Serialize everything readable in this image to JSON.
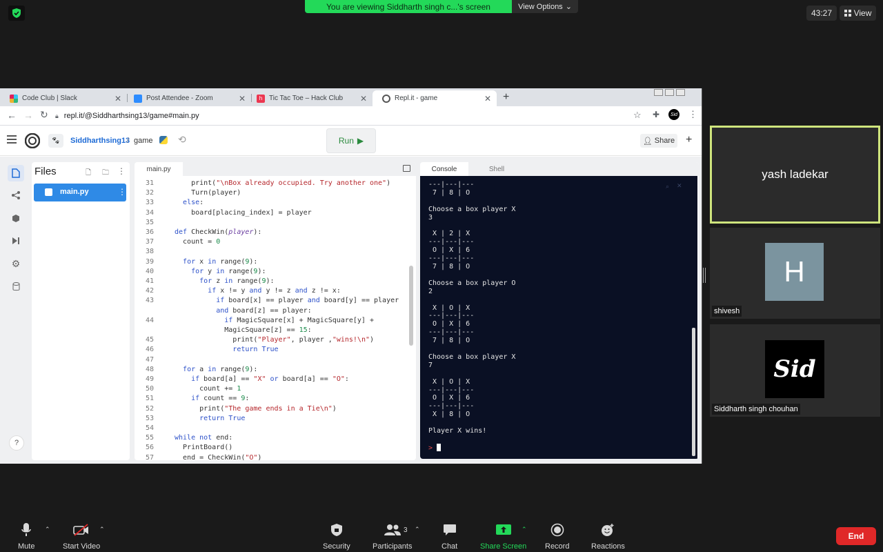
{
  "zoom": {
    "banner_text": "You are viewing Siddharth singh c...'s screen",
    "view_options": "View Options",
    "timer": "43:27",
    "view_label": "View",
    "participants": [
      {
        "name": "yash ladekar",
        "initial": ""
      },
      {
        "name": "shivesh",
        "initial": "H"
      },
      {
        "name": "Siddharth singh chouhan",
        "initial": "Sid"
      }
    ],
    "toolbar": {
      "mute": "Mute",
      "start_video": "Start Video",
      "security": "Security",
      "participants": "Participants",
      "participants_count": "3",
      "chat": "Chat",
      "share_screen": "Share Screen",
      "record": "Record",
      "reactions": "Reactions",
      "end": "End"
    },
    "accent_green": "#23d959",
    "end_red": "#e02828"
  },
  "browser": {
    "tabs": [
      {
        "title": "Code Club | Slack"
      },
      {
        "title": "Post Attendee - Zoom"
      },
      {
        "title": "Tic Tac Toe – Hack Club"
      },
      {
        "title": "Repl.it - game"
      }
    ],
    "url": "repl.it/@Siddharthsing13/game#main.py"
  },
  "replit": {
    "user": "Siddharthsing13",
    "repl_name": "game",
    "run_label": "Run",
    "share_label": "Share",
    "files_title": "Files",
    "file_name": "main.py",
    "editor_tab": "main.py",
    "console_tab": "Console",
    "shell_tab": "Shell",
    "help": "?",
    "code_lines": [
      {
        "n": "31",
        "t": "    print(\"\\nBox already occupied. Try another one\")"
      },
      {
        "n": "32",
        "t": "    Turn(player)"
      },
      {
        "n": "33",
        "t": "  else:"
      },
      {
        "n": "34",
        "t": "    board[placing_index] = player"
      },
      {
        "n": "35",
        "t": ""
      },
      {
        "n": "36",
        "t": "def CheckWin(player):"
      },
      {
        "n": "37",
        "t": "  count = 0"
      },
      {
        "n": "38",
        "t": ""
      },
      {
        "n": "39",
        "t": "  for x in range(9):"
      },
      {
        "n": "40",
        "t": "    for y in range(9):"
      },
      {
        "n": "41",
        "t": "      for z in range(9):"
      },
      {
        "n": "42",
        "t": "        if x != y and y != z and z != x:"
      },
      {
        "n": "43",
        "t": "          if board[x] == player and board[y] == player"
      },
      {
        "n": "",
        "t": "          and board[z] == player:"
      },
      {
        "n": "44",
        "t": "            if MagicSquare[x] + MagicSquare[y] +"
      },
      {
        "n": "",
        "t": "            MagicSquare[z] == 15:"
      },
      {
        "n": "45",
        "t": "              print(\"Player\", player ,\"wins!\\n\")"
      },
      {
        "n": "46",
        "t": "              return True"
      },
      {
        "n": "47",
        "t": ""
      },
      {
        "n": "48",
        "t": "  for a in range(9):"
      },
      {
        "n": "49",
        "t": "    if board[a] == \"X\" or board[a] == \"O\":"
      },
      {
        "n": "50",
        "t": "      count += 1"
      },
      {
        "n": "51",
        "t": "    if count == 9:"
      },
      {
        "n": "52",
        "t": "      print(\"The game ends in a Tie\\n\")"
      },
      {
        "n": "53",
        "t": "      return True"
      },
      {
        "n": "54",
        "t": ""
      },
      {
        "n": "55",
        "t": "while not end:"
      },
      {
        "n": "56",
        "t": "  PrintBoard()"
      },
      {
        "n": "57",
        "t": "  end = CheckWin(\"O\")"
      }
    ],
    "console_lines": [
      "---|---|---",
      " 7 | 8 | O",
      "",
      "Choose a box player X",
      "3",
      "",
      " X | 2 | X",
      "---|---|---",
      " O | X | 6",
      "---|---|---",
      " 7 | 8 | O",
      "",
      "Choose a box player O",
      "2",
      "",
      " X | O | X",
      "---|---|---",
      " O | X | 6",
      "---|---|---",
      " 7 | 8 | O",
      "",
      "Choose a box player X",
      "7",
      "",
      " X | O | X",
      "---|---|---",
      " O | X | 6",
      "---|---|---",
      " X | 8 | O",
      "",
      "Player X wins!",
      ""
    ],
    "prompt": ">"
  }
}
